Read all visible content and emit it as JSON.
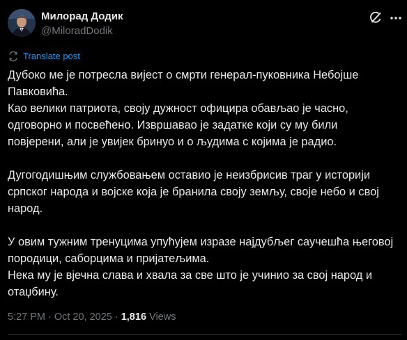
{
  "author": {
    "display_name": "Милорад Додик",
    "handle": "@MiloradDodik",
    "avatar": "avatar-photo"
  },
  "header_icons": [
    "grok-icon",
    "more-icon"
  ],
  "translate": {
    "icon": "translate-icon",
    "label": "Translate post"
  },
  "body": {
    "p1": [
      "Дубоко ме је потресла вијест о смрти генерал-пуковника Небојше",
      "Павковића.",
      "Као велики патриота, своју дужност официра обављао је часно,",
      "одговорно и посвећено. Извршавао је задатке који су му били",
      "повјерени, али је увијек бринуо и о људима с којима је радио."
    ],
    "p2": [
      "Дугогодишњим службовањем оставио је неизбрисив траг у историји",
      "српског народа и војске која је бранила своју земљу, своје небо и свој",
      "народ."
    ],
    "p3": [
      "У овим тужним тренуцима упућујем изразе најдубљег саучешћа његовој",
      "породици, саборцима и пријатељима.",
      "Нека му је вјечна слава и хвала за све што је учинио за свој народ и",
      "отаџбину."
    ]
  },
  "meta": {
    "time": "5:27 PM",
    "separator": "·",
    "date": "Oct 20, 2025",
    "views_count": "1,816",
    "views_label": "Views"
  },
  "colors": {
    "background": "#000000",
    "text": "#e7e9ea",
    "secondary": "#71767b",
    "link": "#1d9bf0",
    "divider": "#2f3336"
  }
}
